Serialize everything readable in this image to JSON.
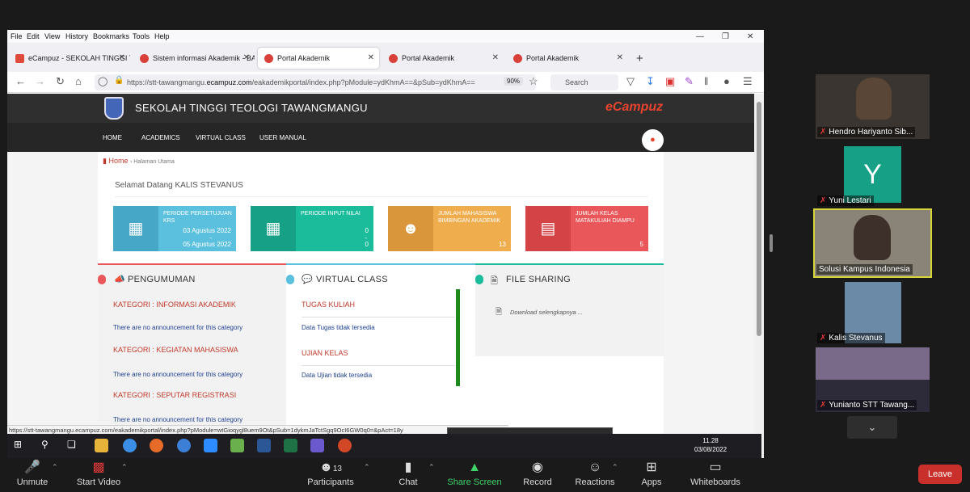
{
  "browser": {
    "menu": [
      "File",
      "Edit",
      "View",
      "History",
      "Bookmarks",
      "Tools",
      "Help"
    ],
    "tabs": [
      {
        "title": "eCampuz - SEKOLAH TINGGI TE"
      },
      {
        "title": "Sistem informasi Akademik - BA"
      },
      {
        "title": "Portal Akademik"
      },
      {
        "title": "Portal Akademik"
      },
      {
        "title": "Portal Akademik"
      }
    ],
    "url_prefix": "https://stt-tawangmangu.",
    "url_domain": "ecampuz.com",
    "url_rest": "/eakademikportal/index.php?pModule=ydKhmA==&pSub=ydKhmA==",
    "zoom": "90%",
    "search_placeholder": "Search",
    "status_url": "https://stt-tawangmangu.ecampuz.com/eakademikportal/index.php?pModule=wtGioqygl8uem9Ot&pSub=1dykmJaTctSgq9OcI6GW0q0=&pAct=18y"
  },
  "site": {
    "title": "SEKOLAH TINGGI TEOLOGI TAWANGMANGU",
    "brand": "eCampuz",
    "nav": [
      "HOME",
      "ACADEMICS",
      "VIRTUAL CLASS",
      "USER MANUAL"
    ],
    "breadcrumb_home": "Home",
    "breadcrumb_sub": "Halaman Utama",
    "welcome": "Selamat Datang KALIS STEVANUS",
    "cards": [
      {
        "label": "PERIODE PERSETUJUAN KRS",
        "v1": "03 Agustus 2022",
        "dash": "-",
        "v2": "05 Agustus 2022",
        "color": "#5bc0de",
        "dark": "#46a8c6"
      },
      {
        "label": "PERIODE INPUT NILAI",
        "v1": "0",
        "dash": "-",
        "v2": "0",
        "color": "#1abc9c",
        "dark": "#16a085"
      },
      {
        "label": "JUMLAH MAHASISWA BIMBINGAN AKADEMIK",
        "v1": "",
        "dash": "",
        "v2": "13",
        "color": "#f0ad4e",
        "dark": "#d9963b"
      },
      {
        "label": "JUMLAH KELAS MATAKULIAH DIAMPU",
        "v1": "",
        "dash": "",
        "v2": "5",
        "color": "#e9575a",
        "dark": "#d44346"
      }
    ],
    "pengumuman": {
      "title": "PENGUMUMAN",
      "categories": [
        {
          "name": "KATEGORI : INFORMASI AKADEMIK",
          "note": "There are no announcement for this category"
        },
        {
          "name": "KATEGORI : KEGIATAN MAHASISWA",
          "note": "There are no announcement for this category"
        },
        {
          "name": "KATEGORI : SEPUTAR REGISTRASI",
          "note": "There are no announcement for this category"
        }
      ]
    },
    "virtual_class": {
      "title": "VIRTUAL CLASS",
      "items": [
        {
          "name": "TUGAS KULIAH",
          "note": "Data Tugas tidak tersedia"
        },
        {
          "name": "UJIAN KELAS",
          "note": "Data Ujian tidak tersedia"
        }
      ]
    },
    "file_sharing": {
      "title": "FILE SHARING",
      "link": "Download selengkapnya ..."
    }
  },
  "taskbar": {
    "time": "11.28",
    "date": "03/08/2022"
  },
  "participants": [
    {
      "name": "Hendro Hariyanto Sib..."
    },
    {
      "name": "Yuni Lestari",
      "initial": "Y"
    },
    {
      "name": "Solusi Kampus Indonesia"
    },
    {
      "name": "Kalis Stevanus"
    },
    {
      "name": "Yunianto STT Tawang..."
    }
  ],
  "zoom_toolbar": {
    "unmute": "Unmute",
    "start_video": "Start Video",
    "participants": "Participants",
    "participants_count": "13",
    "chat": "Chat",
    "share_screen": "Share Screen",
    "record": "Record",
    "reactions": "Reactions",
    "apps": "Apps",
    "whiteboards": "Whiteboards",
    "leave": "Leave"
  }
}
